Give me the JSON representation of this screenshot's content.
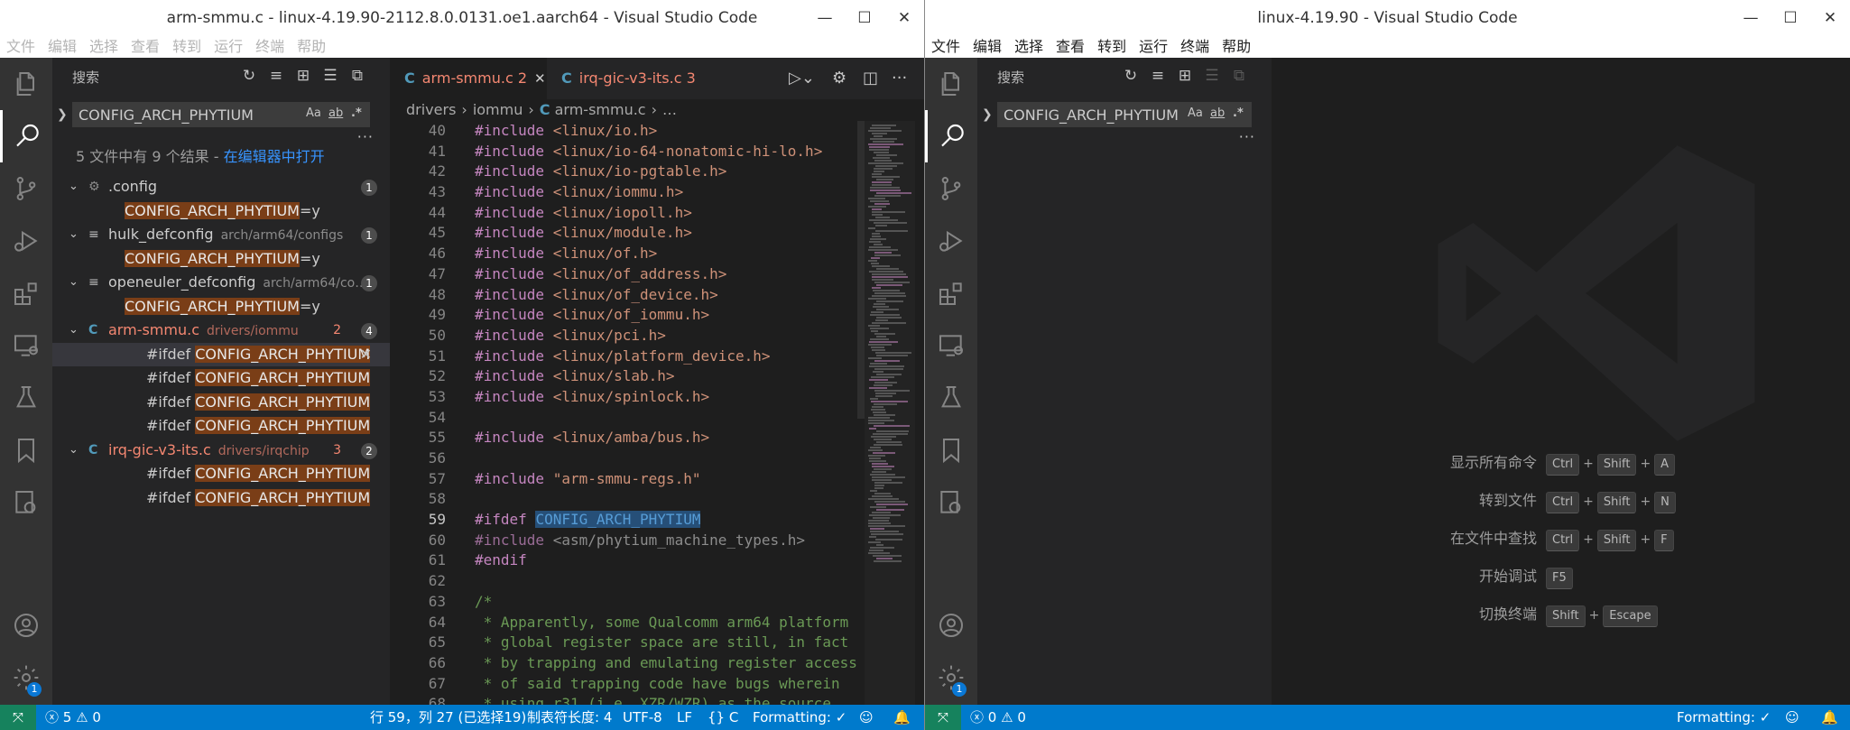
{
  "window1": {
    "title": "arm-smmu.c - linux-4.19.90-2112.8.0.0131.oe1.aarch64 - Visual Studio Code",
    "menu": [
      "文件",
      "编辑",
      "选择",
      "查看",
      "转到",
      "运行",
      "终端",
      "帮助"
    ],
    "sidebar": {
      "title": "搜索",
      "query": "CONFIG_ARCH_PHYTIUM",
      "opt_case": "Aa",
      "opt_word": "ab",
      "opt_regex": ".*",
      "summary_text": "5 文件中有 9 个结果 - ",
      "summary_link": "在编辑器中打开",
      "files": [
        {
          "name": ".config",
          "path": "",
          "count": "1",
          "errors": "",
          "icon": "gear-icon",
          "matches": [
            {
              "pre": "",
              "hit": "CONFIG_ARCH_PHYTIUM",
              "post": "=y"
            }
          ]
        },
        {
          "name": "hulk_defconfig",
          "path": "arch/arm64/configs",
          "count": "1",
          "errors": "",
          "icon": "lines-icon",
          "matches": [
            {
              "pre": "",
              "hit": "CONFIG_ARCH_PHYTIUM",
              "post": "=y"
            }
          ]
        },
        {
          "name": "openeuler_defconfig",
          "path": "arch/arm64/co…",
          "count": "1",
          "errors": "",
          "icon": "lines-icon",
          "matches": [
            {
              "pre": "",
              "hit": "CONFIG_ARCH_PHYTIUM",
              "post": "=y"
            }
          ]
        },
        {
          "name": "arm-smmu.c",
          "path": "drivers/iommu",
          "count": "4",
          "errors": "2",
          "icon": "c-icon",
          "matches": [
            {
              "pre": "#ifdef ",
              "hit": "CONFIG_ARCH_PHYTIUM",
              "post": ""
            },
            {
              "pre": "#ifdef ",
              "hit": "CONFIG_ARCH_PHYTIUM",
              "post": ""
            },
            {
              "pre": "#ifdef ",
              "hit": "CONFIG_ARCH_PHYTIUM",
              "post": ""
            },
            {
              "pre": "#ifdef ",
              "hit": "CONFIG_ARCH_PHYTIUM",
              "post": ""
            }
          ]
        },
        {
          "name": "irq-gic-v3-its.c",
          "path": "drivers/irqchip",
          "count": "2",
          "errors": "3",
          "icon": "c-icon",
          "matches": [
            {
              "pre": "#ifdef ",
              "hit": "CONFIG_ARCH_PHYTIUM",
              "post": ""
            },
            {
              "pre": "#ifdef ",
              "hit": "CONFIG_ARCH_PHYTIUM",
              "post": ""
            }
          ]
        }
      ]
    },
    "tabs": [
      {
        "label": "arm-smmu.c",
        "problems": "2",
        "active": true
      },
      {
        "label": "irq-gic-v3-its.c",
        "problems": "3",
        "active": false
      }
    ],
    "breadcrumb": [
      "drivers",
      "iommu",
      "arm-smmu.c",
      "…"
    ],
    "code": [
      {
        "n": "40",
        "t": "#include <linux/io.h>"
      },
      {
        "n": "41",
        "t": "#include <linux/io-64-nonatomic-hi-lo.h>"
      },
      {
        "n": "42",
        "t": "#include <linux/io-pgtable.h>"
      },
      {
        "n": "43",
        "t": "#include <linux/iommu.h>"
      },
      {
        "n": "44",
        "t": "#include <linux/iopoll.h>"
      },
      {
        "n": "45",
        "t": "#include <linux/module.h>"
      },
      {
        "n": "46",
        "t": "#include <linux/of.h>"
      },
      {
        "n": "47",
        "t": "#include <linux/of_address.h>"
      },
      {
        "n": "48",
        "t": "#include <linux/of_device.h>"
      },
      {
        "n": "49",
        "t": "#include <linux/of_iommu.h>"
      },
      {
        "n": "50",
        "t": "#include <linux/pci.h>"
      },
      {
        "n": "51",
        "t": "#include <linux/platform_device.h>"
      },
      {
        "n": "52",
        "t": "#include <linux/slab.h>"
      },
      {
        "n": "53",
        "t": "#include <linux/spinlock.h>"
      },
      {
        "n": "54",
        "t": ""
      },
      {
        "n": "55",
        "t": "#include <linux/amba/bus.h>"
      },
      {
        "n": "56",
        "t": ""
      },
      {
        "n": "57",
        "t": "#include \"arm-smmu-regs.h\""
      },
      {
        "n": "58",
        "t": ""
      },
      {
        "n": "59",
        "t": "#ifdef CONFIG_ARCH_PHYTIUM"
      },
      {
        "n": "60",
        "t": "#include <asm/phytium_machine_types.h>"
      },
      {
        "n": "61",
        "t": "#endif"
      },
      {
        "n": "62",
        "t": ""
      },
      {
        "n": "63",
        "t": "/*"
      },
      {
        "n": "64",
        "t": " * Apparently, some Qualcomm arm64 platform"
      },
      {
        "n": "65",
        "t": " * global register space are still, in fact"
      },
      {
        "n": "66",
        "t": " * by trapping and emulating register access"
      },
      {
        "n": "67",
        "t": " * of said trapping code have bugs wherein"
      },
      {
        "n": "68",
        "t": " * using r31 (i.e. XZR/WZR) as the source"
      }
    ],
    "status": {
      "problems_errors": "5",
      "problems_warnings": "0",
      "position": "行 59，列 27 (已选择19)",
      "tab_size": "制表符长度: 4",
      "encoding": "UTF-8",
      "eol": "LF",
      "language": "C",
      "formatting": "Formatting: ✓"
    }
  },
  "window2": {
    "title": "linux-4.19.90 - Visual Studio Code",
    "menu": [
      "文件",
      "编辑",
      "选择",
      "查看",
      "转到",
      "运行",
      "终端",
      "帮助"
    ],
    "sidebar": {
      "title": "搜索",
      "query": "CONFIG_ARCH_PHYTIUM",
      "opt_case": "Aa",
      "opt_word": "ab",
      "opt_regex": ".*"
    },
    "shortcuts": [
      {
        "label": "显示所有命令",
        "keys": [
          "Ctrl",
          "Shift",
          "A"
        ]
      },
      {
        "label": "转到文件",
        "keys": [
          "Ctrl",
          "Shift",
          "N"
        ]
      },
      {
        "label": "在文件中查找",
        "keys": [
          "Ctrl",
          "Shift",
          "F"
        ]
      },
      {
        "label": "开始调试",
        "keys": [
          "F5"
        ]
      },
      {
        "label": "切换终端",
        "keys": [
          "Shift",
          "Escape"
        ]
      }
    ],
    "status": {
      "problems_errors": "0",
      "problems_warnings": "0",
      "formatting": "Formatting: ✓"
    }
  },
  "account_badge": "1",
  "colors": {
    "statusbar": "#007acc",
    "remote": "#16825d",
    "match_highlight": "#7a3e17",
    "selection": "#264f78"
  }
}
